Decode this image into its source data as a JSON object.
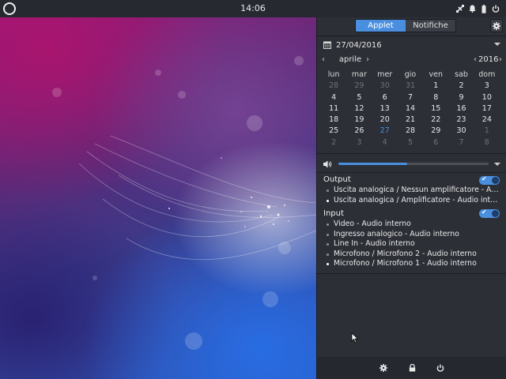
{
  "topbar": {
    "clock": "14:06",
    "tray_icons": [
      "network-icon",
      "notification-bell-icon",
      "battery-icon",
      "power-icon"
    ]
  },
  "panel": {
    "tabs": [
      {
        "label": "Applet",
        "active": true
      },
      {
        "label": "Notifiche",
        "active": false
      }
    ],
    "date": "27/04/2016",
    "calendar": {
      "month": "aprile",
      "year": "2016",
      "weekdays": [
        "lun",
        "mar",
        "mer",
        "gio",
        "ven",
        "sab",
        "dom"
      ],
      "weeks": [
        [
          {
            "d": "28",
            "dim": true
          },
          {
            "d": "29",
            "dim": true
          },
          {
            "d": "30",
            "dim": true
          },
          {
            "d": "31",
            "dim": true
          },
          {
            "d": "1"
          },
          {
            "d": "2"
          },
          {
            "d": "3"
          }
        ],
        [
          {
            "d": "4"
          },
          {
            "d": "5"
          },
          {
            "d": "6"
          },
          {
            "d": "7"
          },
          {
            "d": "8"
          },
          {
            "d": "9"
          },
          {
            "d": "10"
          }
        ],
        [
          {
            "d": "11"
          },
          {
            "d": "12"
          },
          {
            "d": "13"
          },
          {
            "d": "14"
          },
          {
            "d": "15"
          },
          {
            "d": "16"
          },
          {
            "d": "17"
          }
        ],
        [
          {
            "d": "18"
          },
          {
            "d": "19"
          },
          {
            "d": "20"
          },
          {
            "d": "21"
          },
          {
            "d": "22"
          },
          {
            "d": "23"
          },
          {
            "d": "24"
          }
        ],
        [
          {
            "d": "25"
          },
          {
            "d": "26"
          },
          {
            "d": "27",
            "today": true
          },
          {
            "d": "28"
          },
          {
            "d": "29"
          },
          {
            "d": "30"
          },
          {
            "d": "1",
            "dim": true
          }
        ],
        [
          {
            "d": "2",
            "dim": true
          },
          {
            "d": "3",
            "dim": true
          },
          {
            "d": "4",
            "dim": true
          },
          {
            "d": "5",
            "dim": true
          },
          {
            "d": "6",
            "dim": true
          },
          {
            "d": "7",
            "dim": true
          },
          {
            "d": "8",
            "dim": true
          }
        ]
      ]
    },
    "volume": {
      "level_percent": 46
    },
    "output": {
      "title": "Output",
      "enabled": true,
      "devices": [
        {
          "label": "Uscita analogica / Nessun amplificatore - Audio interno",
          "selected": false
        },
        {
          "label": "Uscita analogica / Amplificatore - Audio interno",
          "selected": true
        }
      ]
    },
    "input": {
      "title": "Input",
      "enabled": true,
      "devices": [
        {
          "label": "Video - Audio interno",
          "selected": false
        },
        {
          "label": "Ingresso analogico - Audio interno",
          "selected": false
        },
        {
          "label": "Line In - Audio interno",
          "selected": false
        },
        {
          "label": "Microfono / Microfono 2 - Audio interno",
          "selected": false
        },
        {
          "label": "Microfono / Microfono 1 - Audio interno",
          "selected": true
        }
      ]
    },
    "bottom_buttons": [
      "settings-icon",
      "lock-icon",
      "power-icon"
    ]
  },
  "colors": {
    "accent": "#4a8fdf",
    "panel_bg": "#2c2f36",
    "topbar_bg": "#26292f"
  }
}
